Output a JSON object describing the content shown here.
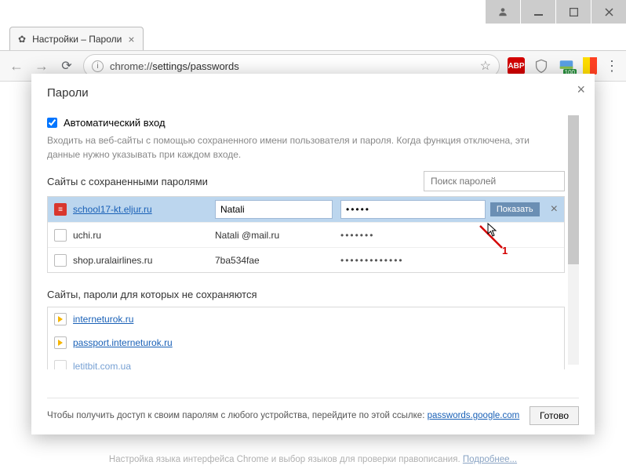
{
  "window": {
    "tab_title": "Настройки – Пароли",
    "url_prefix": "chrome://",
    "url_path": "settings/passwords",
    "ext_badge": "100"
  },
  "dialog": {
    "title": "Пароли",
    "auto_login_label": "Автоматический вход",
    "auto_login_hint": "Входить на веб-сайты с помощью сохраненного имени пользователя и пароля. Когда функция отключена, эти данные нужно указывать при каждом входе.",
    "saved_title": "Сайты с сохраненными паролями",
    "search_placeholder": "Поиск паролей",
    "show_label": "Показать",
    "rows": [
      {
        "site": "school17-kt.eljur.ru",
        "user": "Natali",
        "pw": "•••••",
        "selected": true,
        "favicon": "red"
      },
      {
        "site": "uchi.ru",
        "user": "Natali @mail.ru",
        "pw": "•••••••",
        "selected": false,
        "favicon": "blank"
      },
      {
        "site": "shop.uralairlines.ru",
        "user": "7ba534fae",
        "pw": "•••••••••••••",
        "selected": false,
        "favicon": "blank"
      }
    ],
    "never_title": "Сайты, пароли для которых не сохраняются",
    "never_rows": [
      {
        "site": "interneturok.ru"
      },
      {
        "site": "passport.interneturok.ru"
      },
      {
        "site": "letitbit.com.ua"
      }
    ],
    "footer_text": "Чтобы получить доступ к своим паролям с любого устройства, перейдите по этой ссылке: ",
    "footer_link": "passwords.google.com",
    "done": "Готово"
  },
  "bg": {
    "text": "Настройка языка интерфейса Chrome и выбор языков для проверки правописания. ",
    "link": "Подробнее..."
  },
  "annotation": {
    "label": "1"
  }
}
